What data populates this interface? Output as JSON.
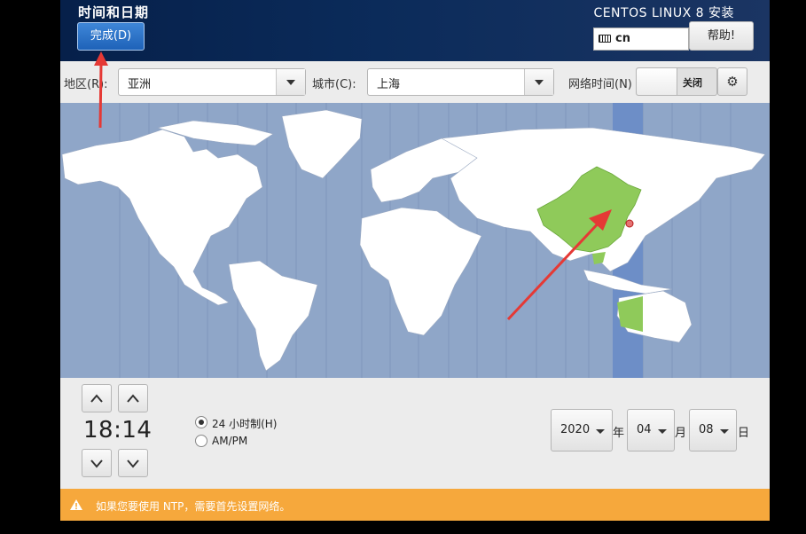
{
  "header": {
    "title": "时间和日期",
    "done_label": "完成(D)",
    "install_title": "CENTOS LINUX 8 安装",
    "keyboard_layout": "cn",
    "help_label": "帮助!"
  },
  "toolbar": {
    "region_label": "地区(R):",
    "region_value": "亚洲",
    "city_label": "城市(C):",
    "city_value": "上海",
    "ntp_label": "网络时间(N)",
    "ntp_state": "关闭"
  },
  "time": {
    "value": "18:14",
    "format_24h_label": "24 小时制(H)",
    "format_ampm_label": "AM/PM",
    "selected_format": "24h"
  },
  "date": {
    "year": "2020",
    "year_unit": "年",
    "month": "04",
    "month_unit": "月",
    "day": "08",
    "day_unit": "日"
  },
  "warning": {
    "text": "如果您要使用 NTP，需要首先设置网络。"
  },
  "colors": {
    "ocean": "#8fa6c8",
    "land": "#ffffff",
    "selected_zone": "#6d8ec7",
    "highlight_country": "#8fca5a",
    "warning_bar": "#f6a83c",
    "annotation_arrow": "#e53935",
    "done_button": "#2a6fc4"
  }
}
